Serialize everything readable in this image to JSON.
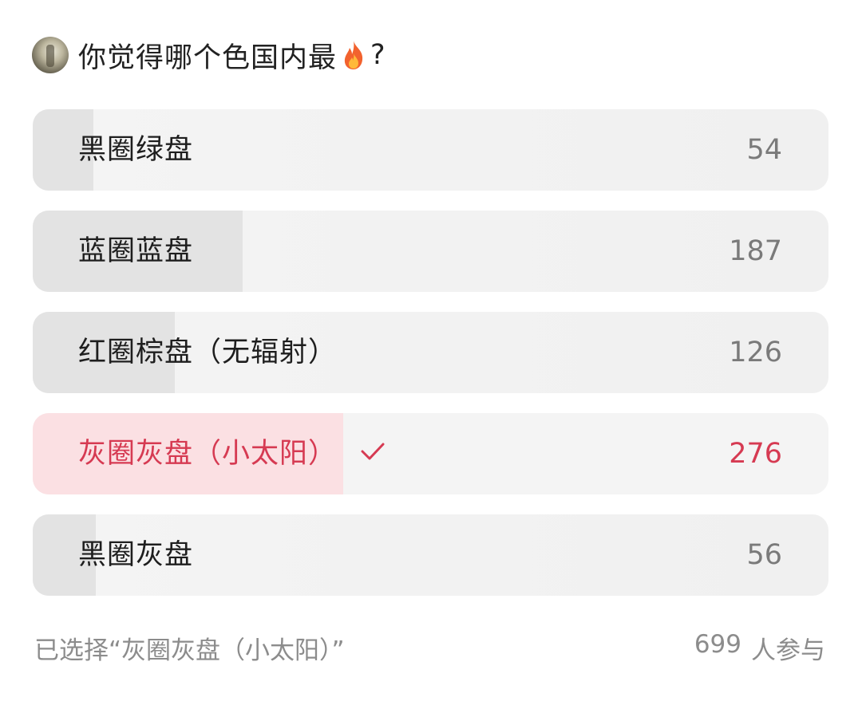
{
  "poll": {
    "question": "你觉得哪个色国内最",
    "question_icon": "fire-icon",
    "question_suffix": "?",
    "options": [
      {
        "label": "黑圈绿盘",
        "count": "54",
        "votes": 54,
        "selected": false
      },
      {
        "label": "蓝圈蓝盘",
        "count": "187",
        "votes": 187,
        "selected": false
      },
      {
        "label": "红圈棕盘（无辐射）",
        "count": "126",
        "votes": 126,
        "selected": false
      },
      {
        "label": "灰圈灰盘（小太阳）",
        "count": "276",
        "votes": 276,
        "selected": true
      },
      {
        "label": "黑圈灰盘",
        "count": "56",
        "votes": 56,
        "selected": false
      }
    ],
    "selected_text": "已选择“灰圈灰盘（小太阳）”",
    "participants_count": "699",
    "participants_label": "人参与",
    "selected_color": "#d63a52",
    "selected_fill_color": "#fbe0e3",
    "fill_color": "#e3e3e3",
    "track_color": "#f2f2f2"
  }
}
